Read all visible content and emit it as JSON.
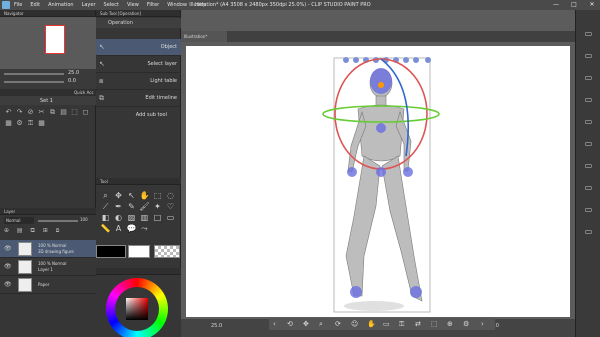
{
  "window": {
    "title": "Illustration* (A4 3508 x 2480px 350dpi 25.0%) - CLIP STUDIO PAINT PRO",
    "minimize": "—",
    "maximize": "□",
    "close": "✕"
  },
  "menu": [
    "File",
    "Edit",
    "Animation",
    "Layer",
    "Select",
    "View",
    "Filter",
    "Window",
    "Help"
  ],
  "navigator": {
    "title": "Navigator",
    "zoom": "25.0",
    "rotation": "0.0"
  },
  "quick_access": {
    "label": "Quick Acc",
    "set_name": "Set 1"
  },
  "sub_tool": {
    "title": "Sub Tool [Operation]",
    "group": "Operation",
    "items": [
      "Object",
      "Select layer",
      "Light table",
      "Edit timeline"
    ],
    "add_label": "Add sub tool"
  },
  "tool_panel": {
    "title": "Tool"
  },
  "layers": {
    "title": "Layer",
    "blend_mode": "Normal",
    "opacity": "100",
    "rows": [
      {
        "line1": "100 % Normal",
        "line2": "3D drawing figure"
      },
      {
        "line1": "100 % Normal",
        "line2": "Layer 1"
      },
      {
        "line1": "",
        "line2": "Paper"
      }
    ]
  },
  "canvas": {
    "tab_label": "Illustration*",
    "zoom_status": "25.0",
    "rotation_status": "0.0"
  },
  "colors": {
    "accent": "#6fb0e0",
    "main_color": "#000000",
    "sub_color": "#ffffff"
  }
}
